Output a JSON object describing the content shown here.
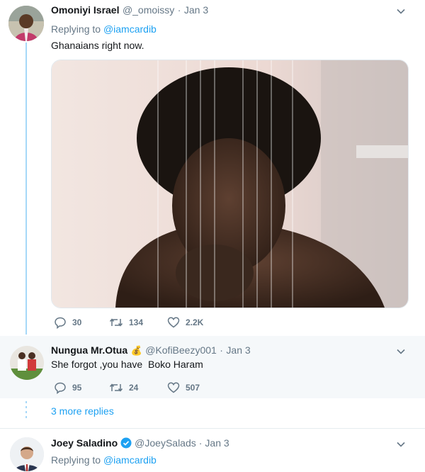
{
  "tweet1": {
    "name": "Omoniyi Israel",
    "handle": "@_omoissy",
    "date": "Jan 3",
    "reply_prefix": "Replying to",
    "reply_handle": "@iamcardib",
    "text": "Ghanaians right now.",
    "replies": "30",
    "retweets": "134",
    "likes": "2.2K"
  },
  "tweet2": {
    "name": "Nungua Mr.Otua",
    "emoji": "💰",
    "handle": "@KofiBeezy001",
    "date": "Jan 3",
    "text": "She forgot ,you have  Boko Haram",
    "replies": "95",
    "retweets": "24",
    "likes": "507"
  },
  "more_replies": "3 more replies",
  "tweet3": {
    "name": "Joey Saladino",
    "handle": "@JoeySalads",
    "date": "Jan 3",
    "reply_prefix": "Replying to",
    "reply_handle": "@iamcardib"
  },
  "colors": {
    "accent": "#1da1f2",
    "thread": "#a6d8f8",
    "muted": "#657786"
  }
}
